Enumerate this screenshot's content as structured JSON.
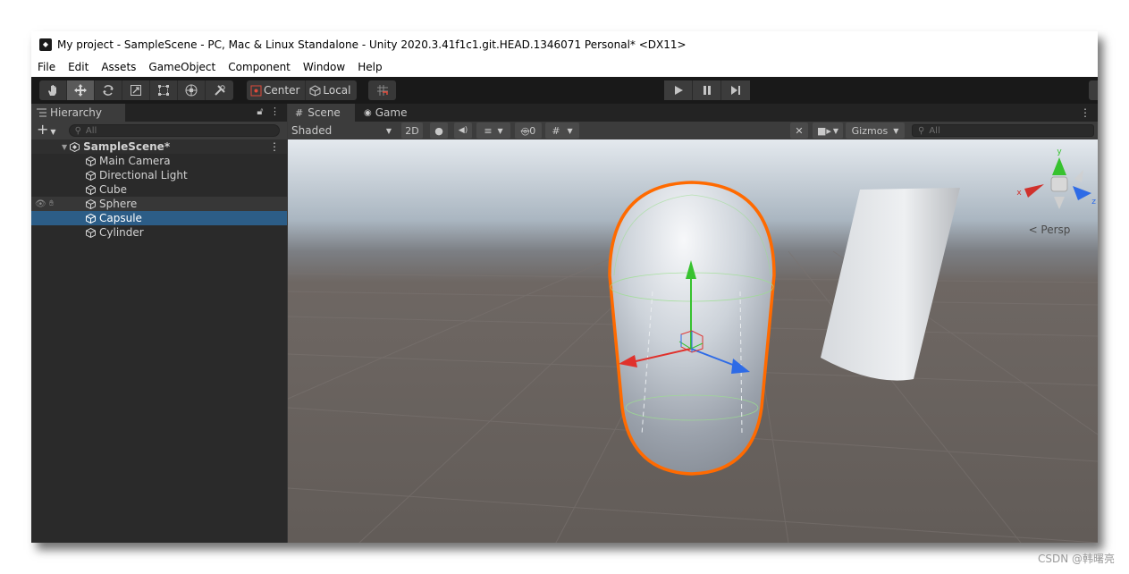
{
  "window": {
    "title": "My project - SampleScene - PC, Mac & Linux Standalone - Unity 2020.3.41f1c1.git.HEAD.1346071 Personal* <DX11>"
  },
  "menu": [
    "File",
    "Edit",
    "Assets",
    "GameObject",
    "Component",
    "Window",
    "Help"
  ],
  "toolbar": {
    "tools": [
      "hand-tool",
      "move-tool",
      "rotate-tool",
      "scale-tool",
      "rect-tool",
      "transform-tool",
      "custom-tool"
    ],
    "active_tool": "move-tool",
    "pivot_label": "Center",
    "space_label": "Local"
  },
  "hierarchy": {
    "tab_label": "Hierarchy",
    "search_placeholder": "All",
    "scene_name": "SampleScene*",
    "items": [
      {
        "label": "Main Camera"
      },
      {
        "label": "Directional Light"
      },
      {
        "label": "Cube"
      },
      {
        "label": "Sphere"
      },
      {
        "label": "Capsule"
      },
      {
        "label": "Cylinder"
      }
    ],
    "selected": "Capsule",
    "hovered": "Sphere"
  },
  "scene": {
    "tabs": [
      "Scene",
      "Game"
    ],
    "active_tab": "Scene",
    "shading_mode": "Shaded",
    "mode_2d": "2D",
    "hidden_count": "0",
    "gizmos_label": "Gizmos",
    "search_placeholder": "All",
    "persp_label": "< Persp",
    "axis_y": "y",
    "axis_x": "x",
    "axis_z": "z"
  },
  "colors": {
    "selection_outline": "#ff6a00",
    "hierarchy_selected": "#2c5d87",
    "axis_x": "#e0312c",
    "axis_y": "#37c22f",
    "axis_z": "#2e6be6"
  },
  "watermark": "CSDN @韩曙亮"
}
